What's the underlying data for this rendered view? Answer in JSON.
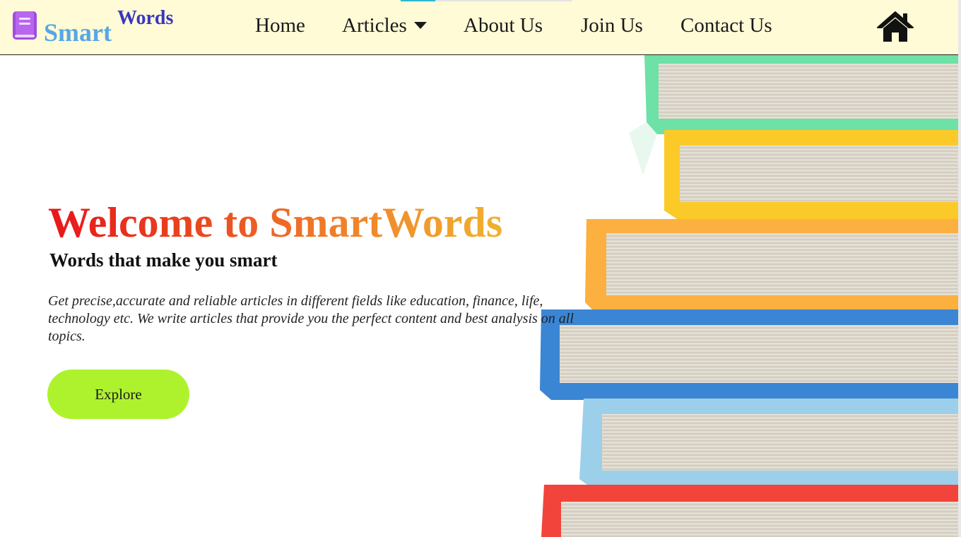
{
  "brand": {
    "part1": "Smart",
    "part2": "Words",
    "icon": "book-icon"
  },
  "nav": {
    "items": [
      {
        "label": "Home"
      },
      {
        "label": "Articles",
        "has_dropdown": true
      },
      {
        "label": "About Us"
      },
      {
        "label": "Join Us"
      },
      {
        "label": "Contact Us"
      }
    ],
    "home_icon": "home-icon"
  },
  "hero": {
    "title": "Welcome to SmartWords",
    "subtitle": "Words that make you smart",
    "description": "Get precise,accurate and reliable articles in different fields like education, finance, life, technology etc. We write articles that provide you the perfect content and best analysis on all topics.",
    "button_label": "Explore",
    "image": "stacked-colorful-books"
  },
  "colors": {
    "navbar_bg": "#fefbd6",
    "brand_smart": "#58a6e6",
    "brand_words": "#3a36c0",
    "title_gradient": [
      "#e8161a",
      "#f0b22e"
    ],
    "button_bg": "#aef22e",
    "book_icon": "#a14bdf"
  }
}
